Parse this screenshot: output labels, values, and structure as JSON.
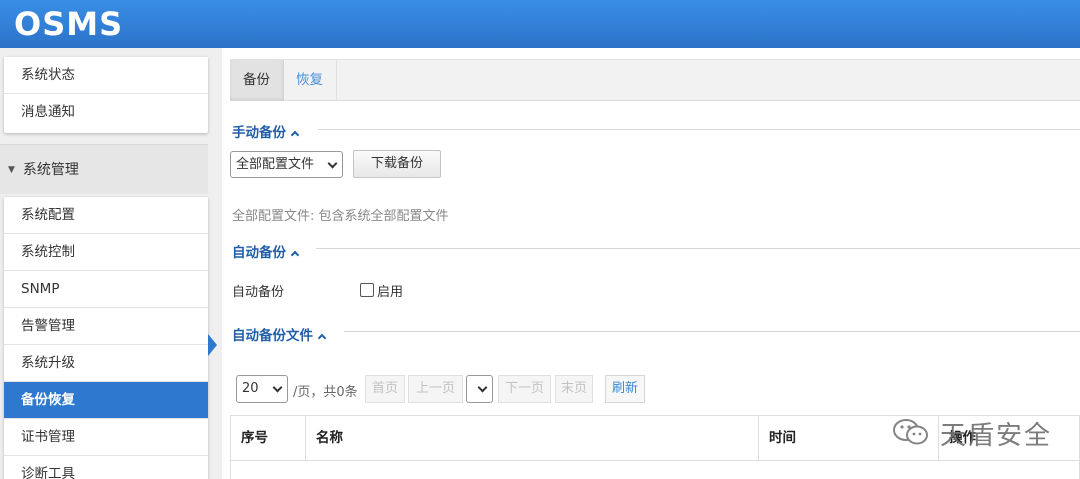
{
  "app": {
    "title": "OSMS"
  },
  "sidebar": {
    "top_items": [
      {
        "label": "系统状态"
      },
      {
        "label": "消息通知"
      }
    ],
    "group": {
      "label": "系统管理"
    },
    "items": [
      {
        "label": "系统配置"
      },
      {
        "label": "系统控制"
      },
      {
        "label": "SNMP"
      },
      {
        "label": "告警管理"
      },
      {
        "label": "系统升级"
      },
      {
        "label": "备份恢复",
        "active": true
      },
      {
        "label": "证书管理"
      },
      {
        "label": "诊断工具"
      }
    ]
  },
  "tabs": [
    {
      "label": "备份",
      "active": true
    },
    {
      "label": "恢复"
    }
  ],
  "manual_backup": {
    "title": "手动备份",
    "select_value": "全部配置文件",
    "download_label": "下载备份",
    "hint": "全部配置文件: 包含系统全部配置文件"
  },
  "auto_backup": {
    "title": "自动备份",
    "label": "自动备份",
    "checkbox_label": "启用",
    "enabled": false
  },
  "auto_backup_files": {
    "title": "自动备份文件",
    "pager": {
      "page_size": "20",
      "summary": "/页，共0条",
      "first": "首页",
      "prev": "上一页",
      "next": "下一页",
      "last": "末页",
      "refresh": "刷新"
    },
    "columns": [
      "序号",
      "名称",
      "时间",
      "操作"
    ]
  },
  "watermark": {
    "text": "天盾安全"
  },
  "colors": {
    "header": "#2b73c8",
    "active": "#2e78cf",
    "section_title": "#1f5fa8",
    "link": "#3a86d6"
  }
}
